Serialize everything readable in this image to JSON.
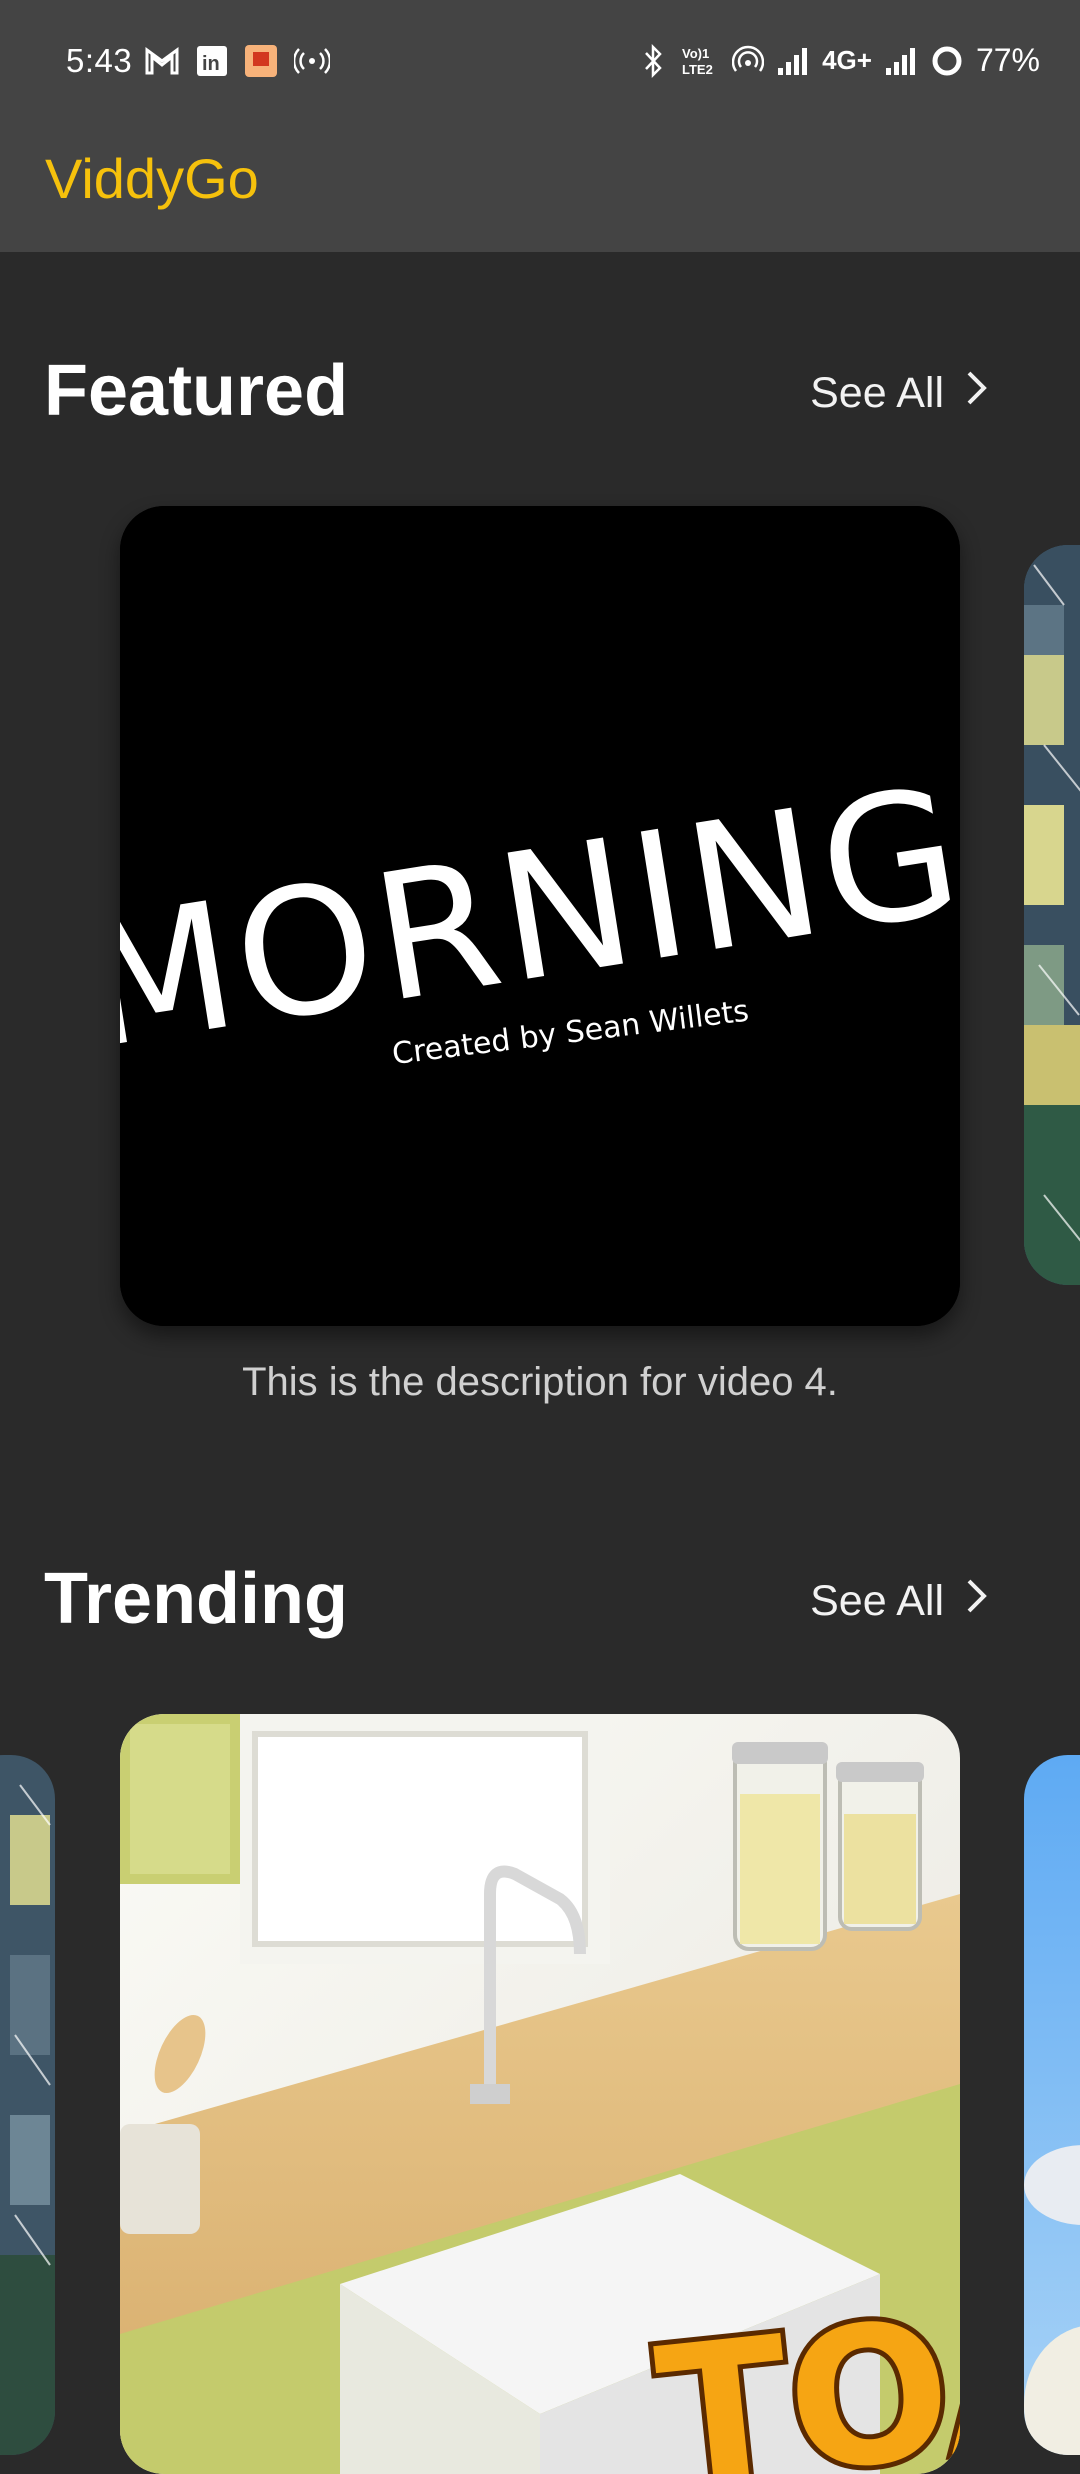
{
  "status_bar": {
    "time": "5:43",
    "left_icons": [
      "gmail-icon",
      "linkedin-icon",
      "app-notification-icon",
      "hotspot-icon"
    ],
    "right_icons": [
      "bluetooth-icon",
      "volte-icon",
      "wifi-calling-icon",
      "signal-icon",
      "network-4g-icon",
      "signal-icon",
      "battery-saver-icon"
    ],
    "network_label": "4G+",
    "battery": "77%"
  },
  "app_bar": {
    "title": "ViddyGo"
  },
  "sections": {
    "featured": {
      "title": "Featured",
      "see_all": "See All",
      "card_title": "MORNING",
      "card_subtitle": "Created by Sean Willets",
      "description": "This is the description for video 4."
    },
    "trending": {
      "title": "Trending",
      "see_all": "See All",
      "card_partial_text": "TOA"
    }
  },
  "colors": {
    "accent": "#f6c10c",
    "background": "#2a2a2a",
    "app_bar": "#444444"
  }
}
